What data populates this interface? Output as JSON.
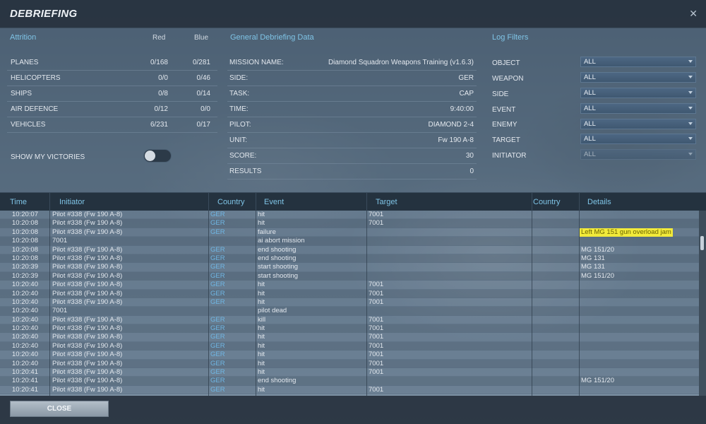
{
  "window": {
    "title": "DEBRIEFING",
    "close_glyph": "✕"
  },
  "attrition": {
    "heading": "Attrition",
    "col_red": "Red",
    "col_blue": "Blue",
    "rows": [
      {
        "label": "PLANES",
        "red": "0/168",
        "blue": "0/281"
      },
      {
        "label": "HELICOPTERS",
        "red": "0/0",
        "blue": "0/46"
      },
      {
        "label": "SHIPS",
        "red": "0/8",
        "blue": "0/14"
      },
      {
        "label": "AIR DEFENCE",
        "red": "0/12",
        "blue": "0/0"
      },
      {
        "label": "VEHICLES",
        "red": "6/231",
        "blue": "0/17"
      }
    ],
    "show_victories_label": "SHOW MY VICTORIES",
    "show_victories_on": false
  },
  "general": {
    "heading": "General Debriefing Data",
    "rows": [
      {
        "label": "MISSION NAME:",
        "value": "Diamond Squadron Weapons Training (v1.6.3)"
      },
      {
        "label": "SIDE:",
        "value": "GER"
      },
      {
        "label": "TASK:",
        "value": "CAP"
      },
      {
        "label": "TIME:",
        "value": "9:40:00"
      },
      {
        "label": "PILOT:",
        "value": "DIAMOND 2-4"
      },
      {
        "label": "UNIT:",
        "value": "Fw 190 A-8"
      },
      {
        "label": "SCORE:",
        "value": "30"
      },
      {
        "label": "RESULTS",
        "value": "0"
      }
    ]
  },
  "filters": {
    "heading": "Log Filters",
    "items": [
      {
        "label": "OBJECT",
        "value": "ALL"
      },
      {
        "label": "WEAPON",
        "value": "ALL"
      },
      {
        "label": "SIDE",
        "value": "ALL"
      },
      {
        "label": "EVENT",
        "value": "ALL"
      },
      {
        "label": "ENEMY",
        "value": "ALL"
      },
      {
        "label": "TARGET",
        "value": "ALL"
      },
      {
        "label": "INITIATOR",
        "value": "ALL"
      }
    ]
  },
  "log": {
    "columns": [
      "Time",
      "Initiator",
      "Country",
      "Event",
      "Target",
      "Country",
      "Details"
    ],
    "rows": [
      {
        "time": "10:20:07",
        "initiator": "Pilot #338 (Fw 190 A-8)",
        "country": "GER",
        "event": "hit",
        "target": "7001",
        "country2": "",
        "details": ""
      },
      {
        "time": "10:20:08",
        "initiator": "Pilot #338 (Fw 190 A-8)",
        "country": "GER",
        "event": "hit",
        "target": "7001",
        "country2": "",
        "details": ""
      },
      {
        "time": "10:20:08",
        "initiator": "Pilot #338 (Fw 190 A-8)",
        "country": "GER",
        "event": "failure",
        "target": "",
        "country2": "",
        "details": "Left MG 151 gun overload jam",
        "highlight": true
      },
      {
        "time": "10:20:08",
        "initiator": "7001",
        "country": "",
        "event": "ai abort mission",
        "target": "",
        "country2": "",
        "details": ""
      },
      {
        "time": "10:20:08",
        "initiator": "Pilot #338 (Fw 190 A-8)",
        "country": "GER",
        "event": "end shooting",
        "target": "",
        "country2": "",
        "details": "MG 151/20"
      },
      {
        "time": "10:20:08",
        "initiator": "Pilot #338 (Fw 190 A-8)",
        "country": "GER",
        "event": "end shooting",
        "target": "",
        "country2": "",
        "details": "MG 131"
      },
      {
        "time": "10:20:39",
        "initiator": "Pilot #338 (Fw 190 A-8)",
        "country": "GER",
        "event": "start shooting",
        "target": "",
        "country2": "",
        "details": "MG 131"
      },
      {
        "time": "10:20:39",
        "initiator": "Pilot #338 (Fw 190 A-8)",
        "country": "GER",
        "event": "start shooting",
        "target": "",
        "country2": "",
        "details": "MG 151/20"
      },
      {
        "time": "10:20:40",
        "initiator": "Pilot #338 (Fw 190 A-8)",
        "country": "GER",
        "event": "hit",
        "target": "7001",
        "country2": "",
        "details": ""
      },
      {
        "time": "10:20:40",
        "initiator": "Pilot #338 (Fw 190 A-8)",
        "country": "GER",
        "event": "hit",
        "target": "7001",
        "country2": "",
        "details": ""
      },
      {
        "time": "10:20:40",
        "initiator": "Pilot #338 (Fw 190 A-8)",
        "country": "GER",
        "event": "hit",
        "target": "7001",
        "country2": "",
        "details": ""
      },
      {
        "time": "10:20:40",
        "initiator": "7001",
        "country": "",
        "event": "pilot dead",
        "target": "",
        "country2": "",
        "details": ""
      },
      {
        "time": "10:20:40",
        "initiator": "Pilot #338 (Fw 190 A-8)",
        "country": "GER",
        "event": "kill",
        "target": "7001",
        "country2": "",
        "details": ""
      },
      {
        "time": "10:20:40",
        "initiator": "Pilot #338 (Fw 190 A-8)",
        "country": "GER",
        "event": "hit",
        "target": "7001",
        "country2": "",
        "details": ""
      },
      {
        "time": "10:20:40",
        "initiator": "Pilot #338 (Fw 190 A-8)",
        "country": "GER",
        "event": "hit",
        "target": "7001",
        "country2": "",
        "details": ""
      },
      {
        "time": "10:20:40",
        "initiator": "Pilot #338 (Fw 190 A-8)",
        "country": "GER",
        "event": "hit",
        "target": "7001",
        "country2": "",
        "details": ""
      },
      {
        "time": "10:20:40",
        "initiator": "Pilot #338 (Fw 190 A-8)",
        "country": "GER",
        "event": "hit",
        "target": "7001",
        "country2": "",
        "details": ""
      },
      {
        "time": "10:20:40",
        "initiator": "Pilot #338 (Fw 190 A-8)",
        "country": "GER",
        "event": "hit",
        "target": "7001",
        "country2": "",
        "details": ""
      },
      {
        "time": "10:20:41",
        "initiator": "Pilot #338 (Fw 190 A-8)",
        "country": "GER",
        "event": "hit",
        "target": "7001",
        "country2": "",
        "details": ""
      },
      {
        "time": "10:20:41",
        "initiator": "Pilot #338 (Fw 190 A-8)",
        "country": "GER",
        "event": "end shooting",
        "target": "",
        "country2": "",
        "details": "MG 151/20"
      },
      {
        "time": "10:20:41",
        "initiator": "Pilot #338 (Fw 190 A-8)",
        "country": "GER",
        "event": "hit",
        "target": "7001",
        "country2": "",
        "details": ""
      }
    ]
  },
  "footer": {
    "close_label": "CLOSE"
  },
  "colors": {
    "accent": "#7fc4e6",
    "highlight": "#f2ea3a",
    "country_link": "#6fb6e4"
  }
}
